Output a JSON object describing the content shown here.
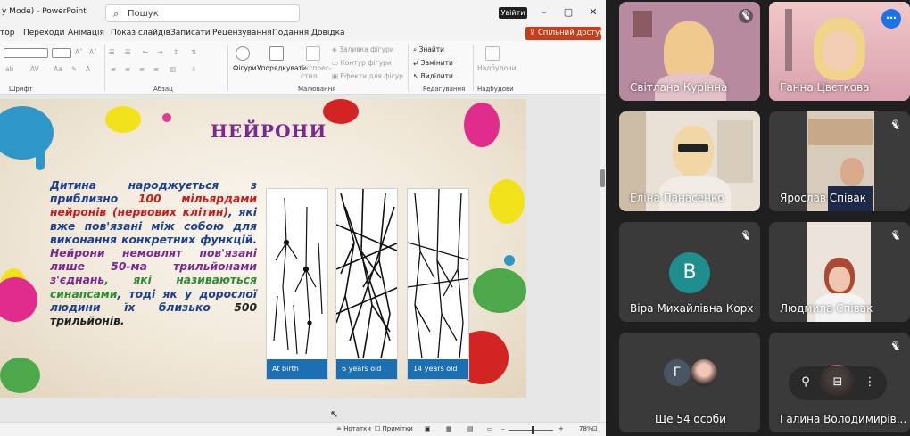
{
  "ppt": {
    "title": "y Mode) - PowerPoint",
    "search_placeholder": "Пошук",
    "signin_label": "Увійти",
    "share_label": "Спільний доступ",
    "menu": [
      "тор",
      "Переходи",
      "Анімація",
      "Показ слайдів",
      "Записати",
      "Рецензування",
      "Подання",
      "Довідка"
    ],
    "ribbon": {
      "font_group": "Шрифт",
      "paragraph_group": "Абзац",
      "drawing_group": "Малювання",
      "editing_group": "Редагування",
      "addins_group": "Надбудови",
      "shapes": "Фігури",
      "arrange": "Упорядкувати",
      "quick_styles": "Експрес-стилі",
      "shape_fill": "Заливка фігури",
      "shape_outline": "Контур фігури",
      "shape_effects": "Ефекти для фігур",
      "find": "Знайти",
      "replace": "Замінити",
      "select": "Виділити",
      "addins": "Надбудови"
    },
    "slide": {
      "title": "НЕЙРОНИ",
      "body": {
        "p1": "Дитина народжується з приблизно ",
        "p2": "100 мільярдами нейронів (нервових клітин)",
        "p3": ", які вже пов'язані між собою для виконання конкретних функцій. ",
        "p4": "Нейрони немовлят пов'язані лише ",
        "p5": "50-ма трильйонами з'єднань",
        "p6": ", які називаються синапсами",
        "p7": ", тоді як у дорослої людини їх близько ",
        "p8": "500 трильйонів",
        "p9": "."
      },
      "panels": [
        "At birth",
        "6 years old",
        "14 years old"
      ]
    },
    "status": {
      "notes": "Нотатки",
      "comments": "Примітки",
      "zoom": "78%"
    }
  },
  "call": {
    "tiles": [
      {
        "name": "Світлана Курінна"
      },
      {
        "name": "Ганна Цвєткова"
      },
      {
        "name": "Еліна Панасенко"
      },
      {
        "name": "Ярослав Співак"
      },
      {
        "name": "Віра Михайлівна Корх",
        "initial": "В"
      },
      {
        "name": "Людмила Співак"
      },
      {
        "name": "Ще 54 особи",
        "initial": "Г"
      },
      {
        "name": "Галина Володимирів..."
      }
    ],
    "colors": {
      "active_outline": "#8ab4f8",
      "avatar_teal": "#1e8e8e",
      "more_blue": "#1a73e8"
    }
  }
}
